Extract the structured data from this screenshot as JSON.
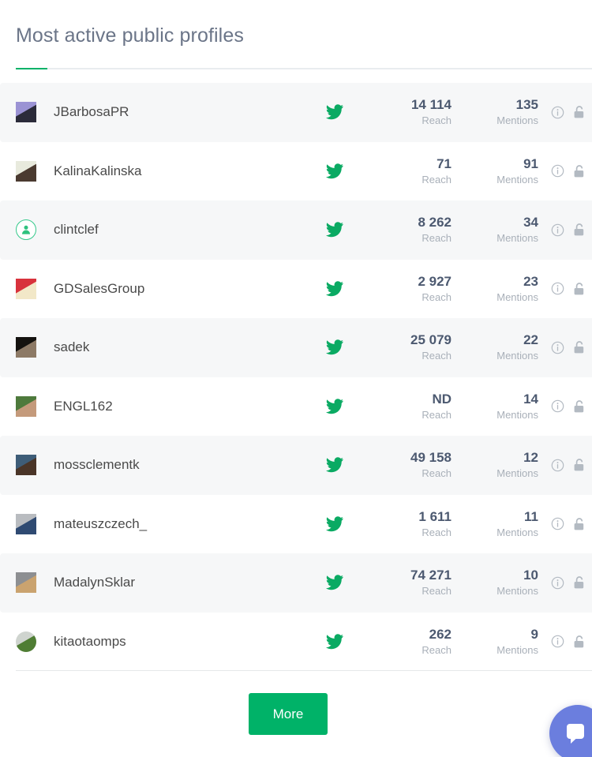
{
  "header": {
    "title": "Most active public profiles",
    "accent_color": "#00b268"
  },
  "columns": {
    "reach_label": "Reach",
    "mentions_label": "Mentions"
  },
  "rows": [
    {
      "name": "JBarbosaPR",
      "network": "twitter-icon",
      "reach": "14 114",
      "reach_label": "Reach",
      "mentions": "135",
      "mentions_label": "Mentions",
      "avatar": "photo",
      "avatar_colors": [
        "#9b93d4",
        "#2b2b3a"
      ]
    },
    {
      "name": "KalinaKalinska",
      "network": "twitter-icon",
      "reach": "71",
      "reach_label": "Reach",
      "mentions": "91",
      "mentions_label": "Mentions",
      "avatar": "photo",
      "avatar_colors": [
        "#e8eadd",
        "#4a3a30"
      ]
    },
    {
      "name": "clintclef",
      "network": "twitter-icon",
      "reach": "8 262",
      "reach_label": "Reach",
      "mentions": "34",
      "mentions_label": "Mentions",
      "avatar": "placeholder",
      "avatar_colors": [
        "#ffffff",
        "#35c98b"
      ]
    },
    {
      "name": "GDSalesGroup",
      "network": "twitter-icon",
      "reach": "2 927",
      "reach_label": "Reach",
      "mentions": "23",
      "mentions_label": "Mentions",
      "avatar": "photo",
      "avatar_colors": [
        "#d8323c",
        "#f2e8c8"
      ]
    },
    {
      "name": "sadek",
      "network": "twitter-icon",
      "reach": "25 079",
      "reach_label": "Reach",
      "mentions": "22",
      "mentions_label": "Mentions",
      "avatar": "photo",
      "avatar_colors": [
        "#14120f",
        "#8d7a66"
      ]
    },
    {
      "name": "ENGL162",
      "network": "twitter-icon",
      "reach": "ND",
      "reach_label": "Reach",
      "mentions": "14",
      "mentions_label": "Mentions",
      "avatar": "photo",
      "avatar_colors": [
        "#4e7a3c",
        "#c49a7b"
      ]
    },
    {
      "name": "mossclementk",
      "network": "twitter-icon",
      "reach": "49 158",
      "reach_label": "Reach",
      "mentions": "12",
      "mentions_label": "Mentions",
      "avatar": "photo",
      "avatar_colors": [
        "#3e5d78",
        "#4a3528"
      ]
    },
    {
      "name": "mateuszczech_",
      "network": "twitter-icon",
      "reach": "1 611",
      "reach_label": "Reach",
      "mentions": "11",
      "mentions_label": "Mentions",
      "avatar": "photo",
      "avatar_colors": [
        "#b9bcc0",
        "#2f4a72"
      ]
    },
    {
      "name": "MadalynSklar",
      "network": "twitter-icon",
      "reach": "74 271",
      "reach_label": "Reach",
      "mentions": "10",
      "mentions_label": "Mentions",
      "avatar": "photo",
      "avatar_colors": [
        "#8d8f92",
        "#caa36f"
      ]
    },
    {
      "name": "kitaotaomps",
      "network": "twitter-icon",
      "reach": "262",
      "reach_label": "Reach",
      "mentions": "9",
      "mentions_label": "Mentions",
      "avatar": "seal",
      "avatar_colors": [
        "#cfd4cf",
        "#4f7d34"
      ]
    }
  ],
  "row_icons": {
    "info": "info-circle-icon",
    "lock": "padlock-icon"
  },
  "footer": {
    "more_label": "More"
  },
  "chat_widget": {
    "icon": "chat-bubble-icon",
    "color": "#6b7ede"
  }
}
